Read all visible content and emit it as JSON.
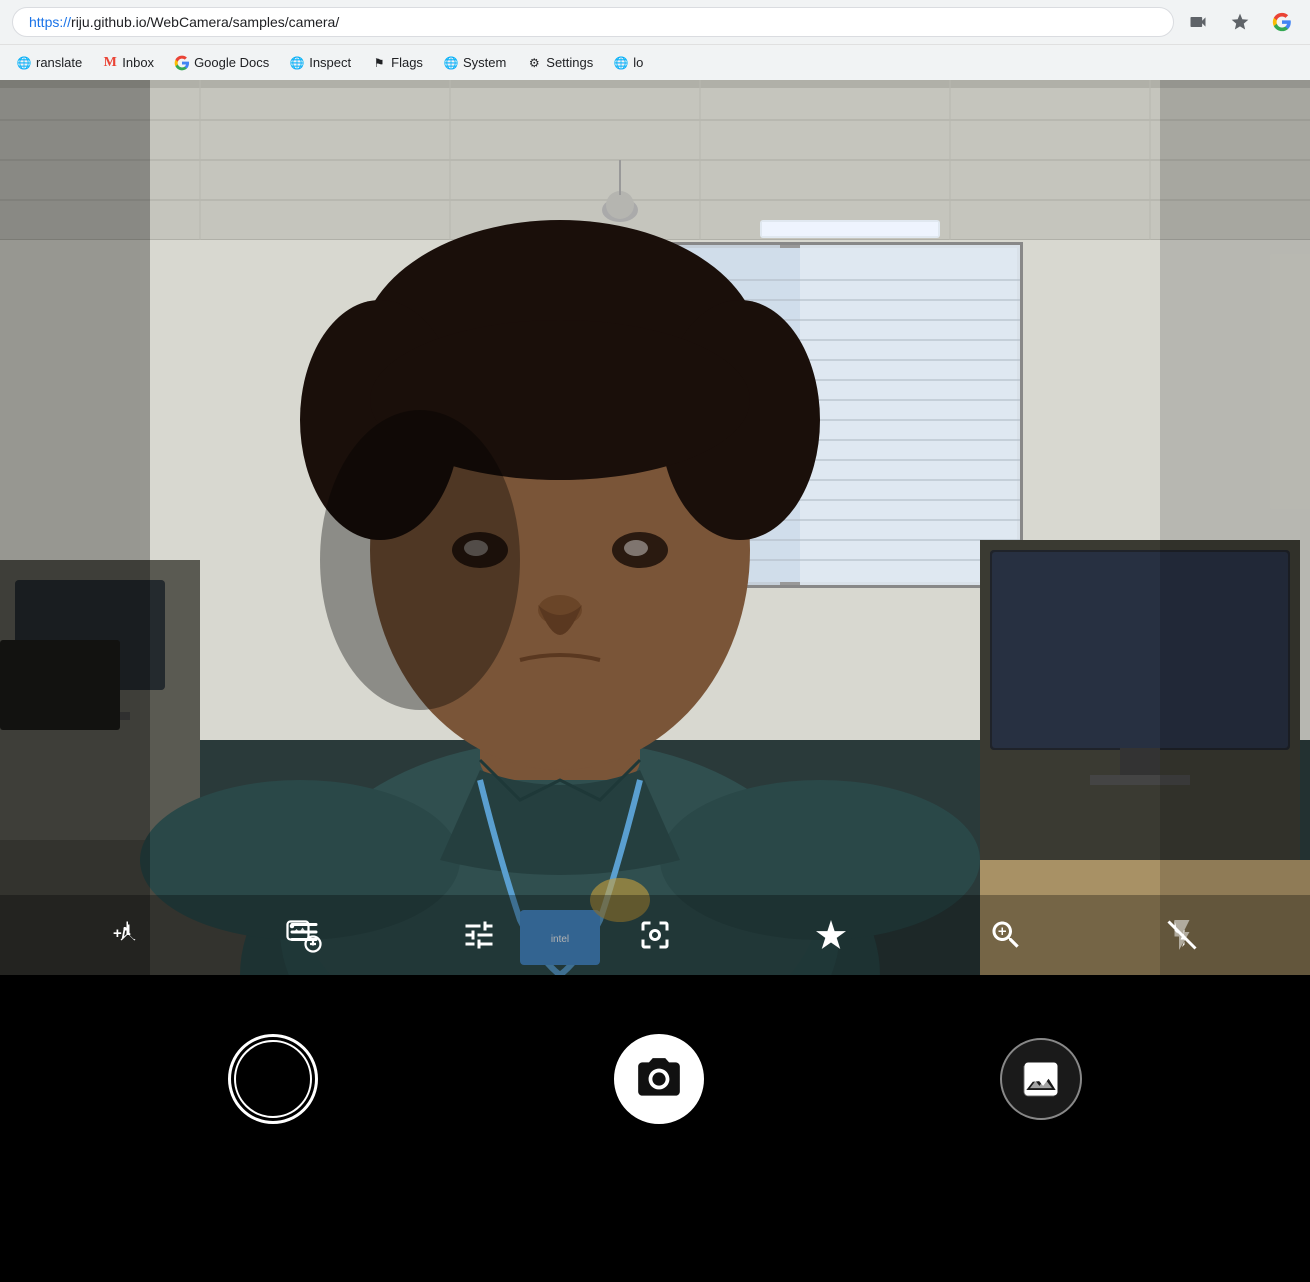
{
  "browser": {
    "url_prefix": "https://",
    "url_domain": "riju.github.io",
    "url_path": "/WebCamera/samples/camera/",
    "full_url": "https://riju.github.io/WebCamera/samples/camera/"
  },
  "bookmarks": [
    {
      "id": "translate",
      "label": "ranslate",
      "icon": "🌐"
    },
    {
      "id": "inbox",
      "label": "Inbox",
      "icon": "M"
    },
    {
      "id": "google-docs",
      "label": "Google Docs",
      "icon": "G"
    },
    {
      "id": "inspect",
      "label": "Inspect",
      "icon": "🌐"
    },
    {
      "id": "flags",
      "label": "Flags",
      "icon": "⚑"
    },
    {
      "id": "system",
      "label": "System",
      "icon": "🌐"
    },
    {
      "id": "settings",
      "label": "Settings",
      "icon": "⚙"
    },
    {
      "id": "lo",
      "label": "lo",
      "icon": "🌐"
    }
  ],
  "camera_controls": [
    {
      "id": "exposure",
      "icon": "exposure"
    },
    {
      "id": "timer",
      "icon": "timer"
    },
    {
      "id": "settings-sliders",
      "icon": "sliders"
    },
    {
      "id": "focus",
      "icon": "focus"
    },
    {
      "id": "hdr",
      "icon": "hdr"
    },
    {
      "id": "zoom",
      "icon": "zoom"
    },
    {
      "id": "flash-off",
      "icon": "flash-off"
    }
  ],
  "bottom_bar": {
    "video_label": "video",
    "capture_label": "capture",
    "gallery_label": "gallery"
  },
  "colors": {
    "address_bar_bg": "#f1f3f4",
    "bookmark_bar_bg": "#f1f3f4",
    "camera_bg": "#2a3a3a",
    "bottom_bar_bg": "#000000",
    "controls_bg": "rgba(0,0,0,0.3)",
    "icon_color": "#ffffff"
  }
}
